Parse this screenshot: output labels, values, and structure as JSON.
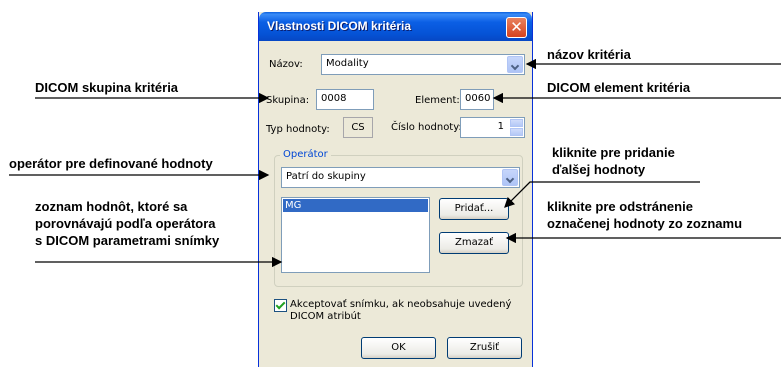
{
  "dialog": {
    "title": "Vlastnosti DICOM kritéria",
    "close_symbol": "✕",
    "name_label": "Názov:",
    "name_value": "Modality",
    "group_label": "Skupina:",
    "group_value": "0008",
    "element_label": "Element:",
    "element_value": "0060",
    "value_type_label": "Typ hodnoty:",
    "value_type_value": "CS",
    "value_number_label": "Číslo hodnoty:",
    "value_number_value": "1",
    "operator_group_label": "Operátor",
    "operator_value": "Patrí do skupiny",
    "list_items": [
      "MG"
    ],
    "add_button": "Pridať...",
    "remove_button": "Zmazať",
    "accept_checkbox_line1": "Akceptovať snímku, ak neobsahuje uvedený",
    "accept_checkbox_line2": "DICOM atribút",
    "ok_button": "OK",
    "cancel_button": "Zrušiť"
  },
  "annotations": {
    "criteria_name": "názov kritéria",
    "dicom_group": "DICOM skupina kritéria",
    "dicom_element": "DICOM element kritéria",
    "operator": "operátor pre definované hodnoty",
    "add_line1": "kliknite pre pridanie",
    "add_line2": "ďalšej hodnoty",
    "values_line1": "zoznam hodnôt, ktoré sa",
    "values_line2": "porovnávajú podľa operátora",
    "values_line3": "s DICOM parametrami snímky",
    "remove_line1": "kliknite pre odstránenie",
    "remove_line2": "označenej hodnoty zo zoznamu"
  },
  "icons": {
    "close": "close-icon",
    "dropdown": "chevron-down-icon",
    "spin": "spin-arrows-icon",
    "check": "checkmark-icon"
  },
  "colors": {
    "titlebar": "#0553d6",
    "dialog_bg": "#ece9d8",
    "selection": "#316ac5",
    "close_button": "#d6421e"
  }
}
